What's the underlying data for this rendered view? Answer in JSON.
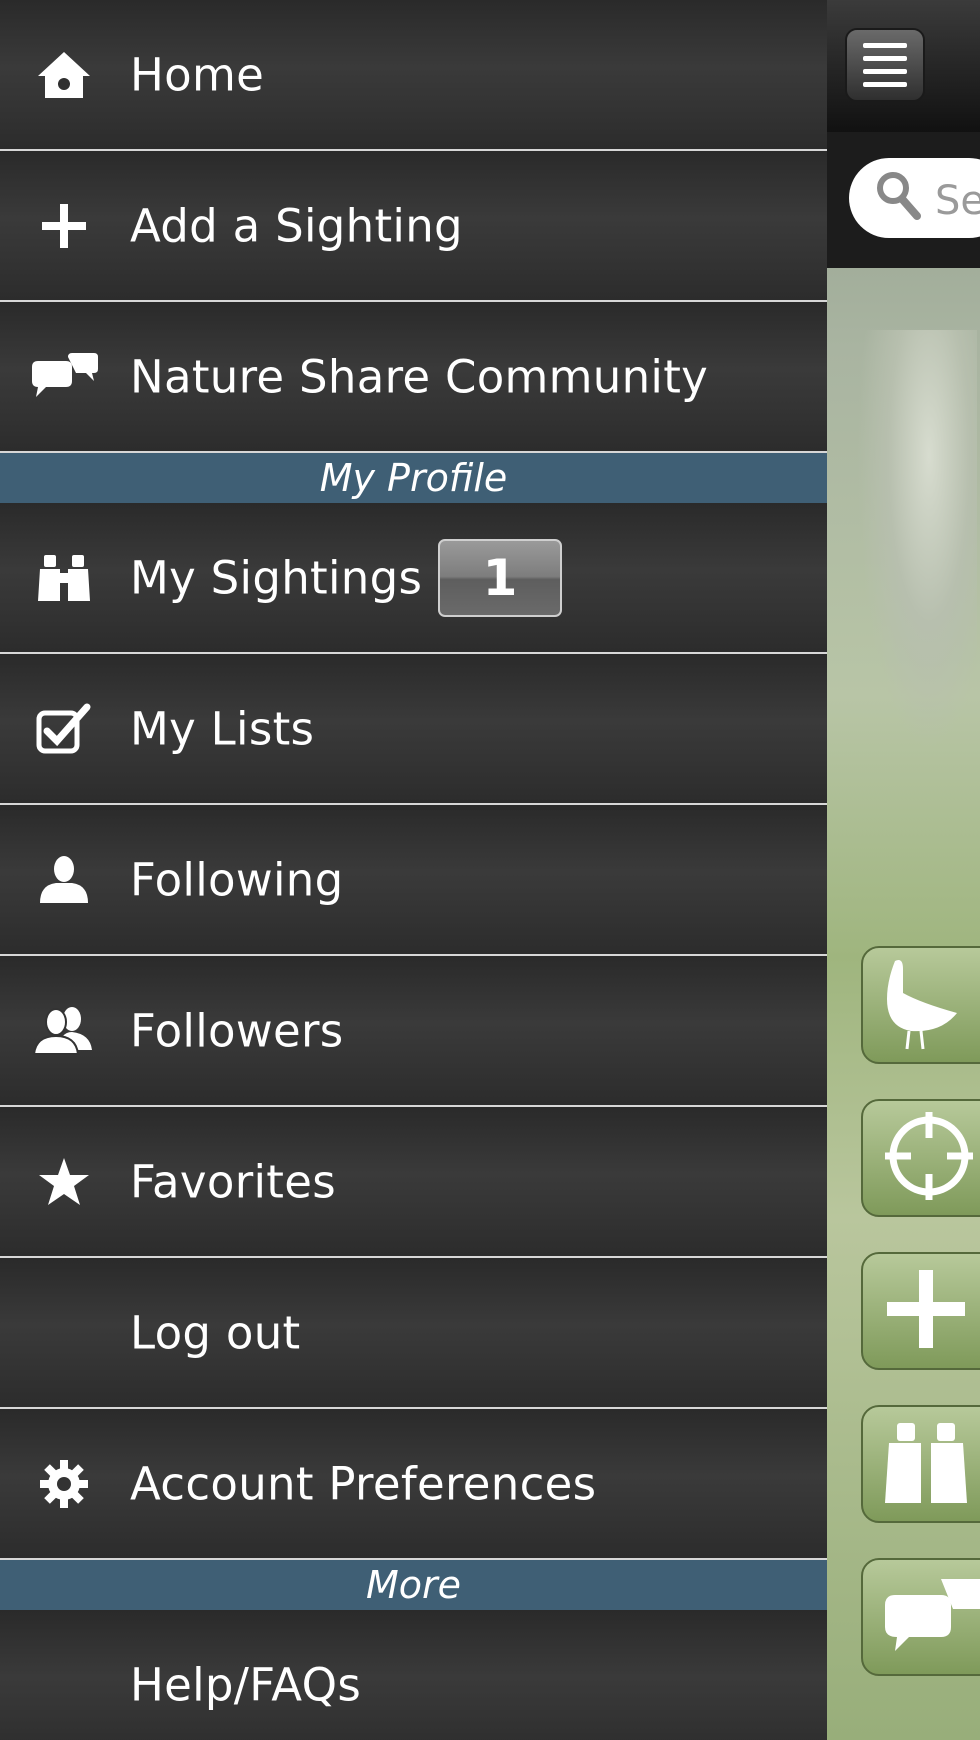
{
  "drawer": {
    "items_top": [
      {
        "label": "Home",
        "icon": "home-icon"
      },
      {
        "label": "Add a Sighting",
        "icon": "plus-icon"
      },
      {
        "label": "Nature Share Community",
        "icon": "chat-bubbles-icon"
      }
    ],
    "section_profile": "My Profile",
    "items_profile": [
      {
        "label": "My Sightings",
        "icon": "binoculars-icon",
        "badge": "1"
      },
      {
        "label": "My Lists",
        "icon": "checkbox-icon"
      },
      {
        "label": "Following",
        "icon": "person-icon"
      },
      {
        "label": "Followers",
        "icon": "people-icon"
      },
      {
        "label": "Favorites",
        "icon": "star-icon"
      },
      {
        "label": "Log out"
      },
      {
        "label": "Account Preferences",
        "icon": "gear-icon"
      }
    ],
    "section_more": "More",
    "items_more": [
      {
        "label": "Help/FAQs"
      }
    ]
  },
  "background_app": {
    "search_placeholder": "Se",
    "side_buttons": [
      "bird-icon",
      "target-icon",
      "plus-icon",
      "binoculars-icon",
      "chat-bubbles-icon"
    ]
  }
}
